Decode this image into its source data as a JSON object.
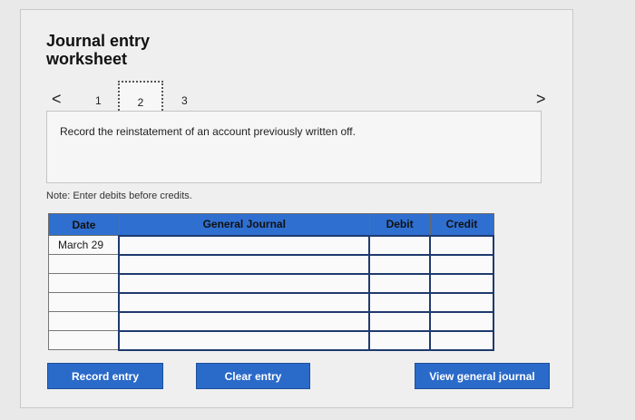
{
  "worksheet": {
    "title": "Journal entry worksheet",
    "nav": {
      "prev": "<",
      "next": ">",
      "pages": [
        "1",
        "2",
        "3"
      ],
      "current": "2"
    },
    "instruction": "Record the reinstatement of an account previously written off.",
    "note": "Note: Enter debits before credits."
  },
  "table": {
    "headers": {
      "date": "Date",
      "general_journal": "General Journal",
      "debit": "Debit",
      "credit": "Credit"
    },
    "rows": [
      {
        "date": "March 29",
        "account": "",
        "debit": "",
        "credit": ""
      },
      {
        "date": "",
        "account": "",
        "debit": "",
        "credit": ""
      },
      {
        "date": "",
        "account": "",
        "debit": "",
        "credit": ""
      },
      {
        "date": "",
        "account": "",
        "debit": "",
        "credit": ""
      },
      {
        "date": "",
        "account": "",
        "debit": "",
        "credit": ""
      },
      {
        "date": "",
        "account": "",
        "debit": "",
        "credit": ""
      }
    ]
  },
  "buttons": {
    "record": "Record entry",
    "clear": "Clear entry",
    "view": "View general journal"
  },
  "colors": {
    "accent": "#2a6ac9",
    "header": "#2f6fd0"
  }
}
